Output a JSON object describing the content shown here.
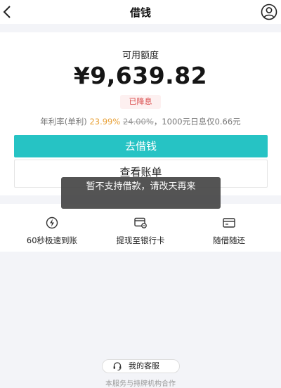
{
  "header": {
    "title": "借钱",
    "back_icon": "chevron-left-icon",
    "profile_icon": "user-circle-icon"
  },
  "quota": {
    "label": "可用额度",
    "amount": "¥9,639.82",
    "badge": "已降息",
    "rate_prefix": "年利率(单利) ",
    "rate_current": "23.99%",
    "rate_old": "24.00%",
    "rate_suffix": "，1000元日息仅0.66元"
  },
  "actions": {
    "borrow_label": "去借钱",
    "bill_label": "查看账单"
  },
  "features": [
    {
      "label": "60秒极速到账",
      "icon": "lightning-circle-icon"
    },
    {
      "label": "提现至银行卡",
      "icon": "bank-card-icon"
    },
    {
      "label": "随借随还",
      "icon": "wallet-card-icon"
    }
  ],
  "service": {
    "label": "我的客服",
    "icon": "headset-icon"
  },
  "footer": {
    "note": "本服务与持牌机构合作"
  },
  "toast": {
    "message": "暂不支持借款，请改天再来"
  },
  "colors": {
    "accent": "#26c3c4",
    "rate_highlight": "#e8a035",
    "badge_text": "#d94a4a",
    "badge_bg": "#fdf0f0",
    "page_bg": "#f3f4f8"
  }
}
